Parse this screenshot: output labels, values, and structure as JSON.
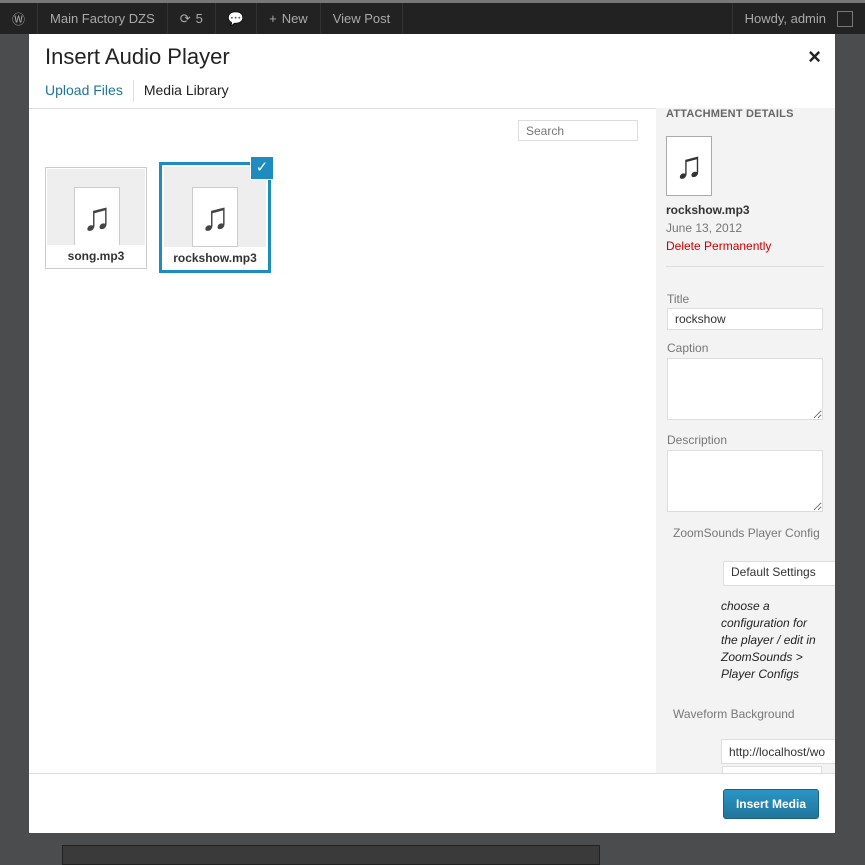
{
  "adminbar": {
    "site": "Main Factory DZS",
    "updates": "5",
    "new": "New",
    "view_post": "View Post",
    "howdy": "Howdy, admin"
  },
  "modal": {
    "title": "Insert Audio Player",
    "close": "×",
    "tabs": [
      "Upload Files",
      "Media Library"
    ],
    "search_placeholder": "Search"
  },
  "items": [
    {
      "name": "song.mp3",
      "selected": false
    },
    {
      "name": "rockshow.mp3",
      "selected": true
    }
  ],
  "details": {
    "heading": "ATTACHMENT DETAILS",
    "filename": "rockshow.mp3",
    "date": "June 13, 2012",
    "delete": "Delete Permanently",
    "title_label": "Title",
    "title_value": "rockshow",
    "caption_label": "Caption",
    "description_label": "Description",
    "config_label": "ZoomSounds Player Config",
    "config_value": "Default Settings",
    "config_hint": "choose a configuration for the player / edit in ZoomSounds > Player Configs",
    "waveform_label": "Waveform Background",
    "waveform_value": "http://localhost/wo"
  },
  "footer": {
    "insert": "Insert Media"
  }
}
